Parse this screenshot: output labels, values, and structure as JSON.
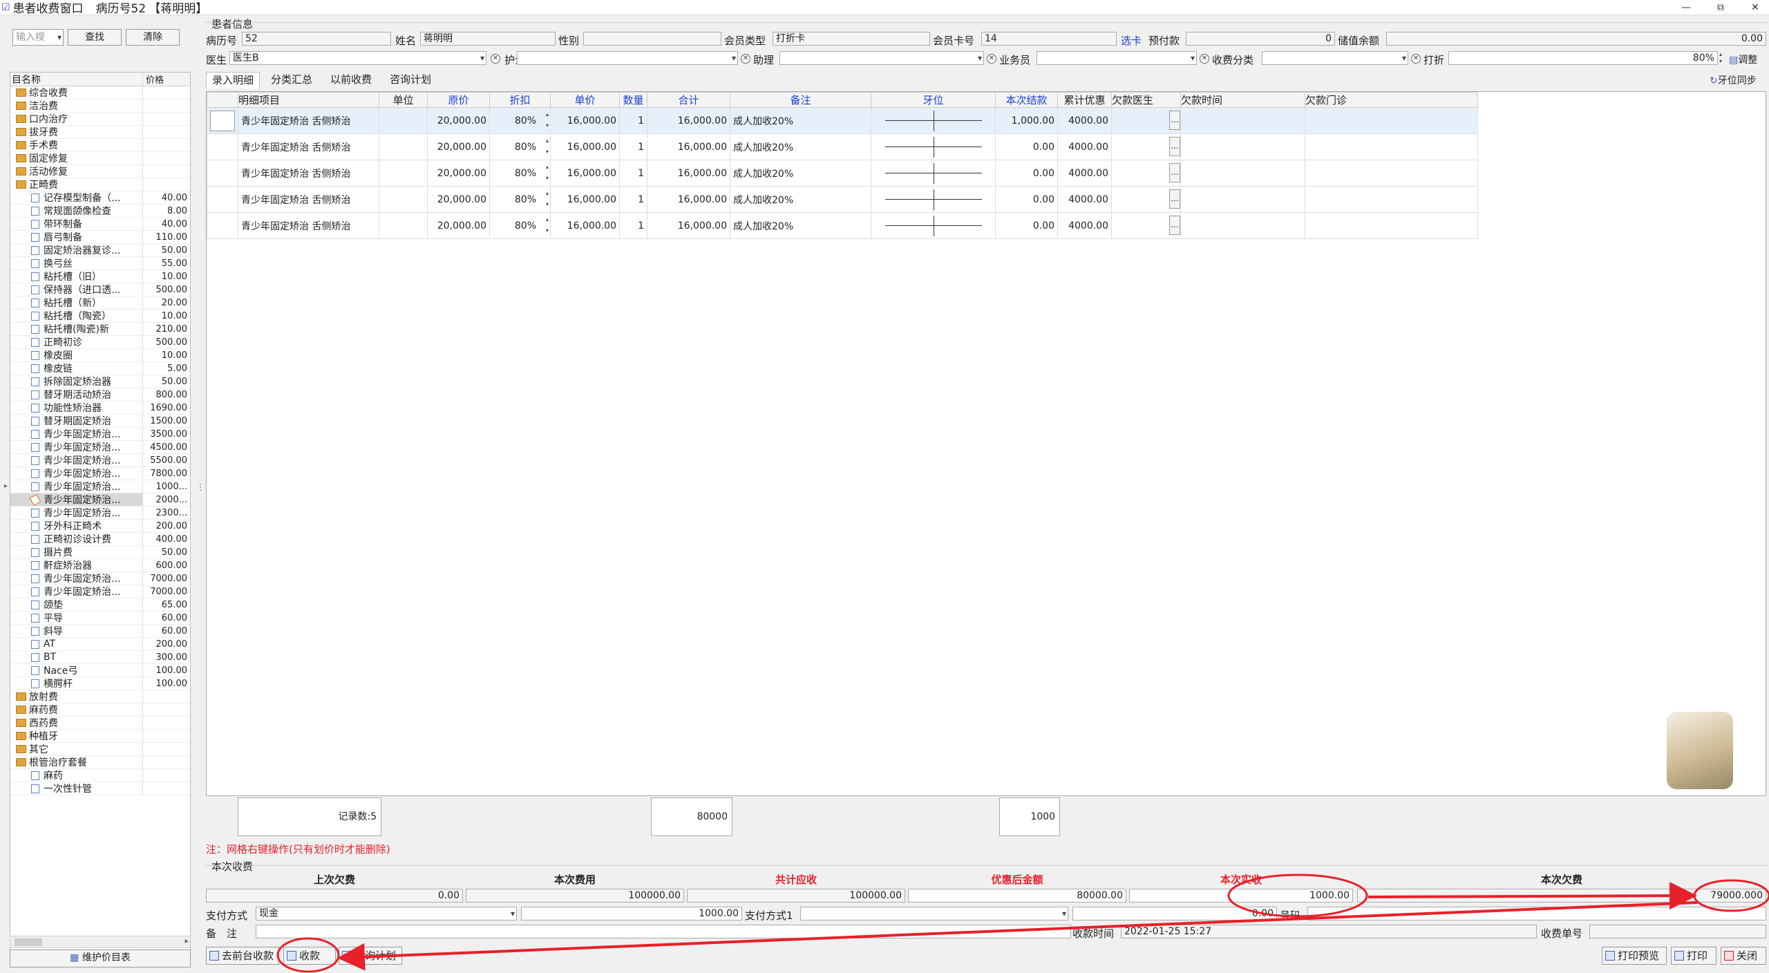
{
  "window": {
    "title": "患者收费窗口",
    "record_label": "病历号52",
    "patient_bracket": "【蒋明明】"
  },
  "sidebar": {
    "search_placeholder": "输入搜",
    "find_btn": "查找",
    "clear_btn": "清除",
    "col_name": "目名称",
    "col_price": "价格",
    "maintain_btn": "维护价目表",
    "items": [
      {
        "name": "综合收费",
        "price": "",
        "type": "folder"
      },
      {
        "name": "洁治费",
        "price": "",
        "type": "folder"
      },
      {
        "name": "口内治疗",
        "price": "",
        "type": "folder"
      },
      {
        "name": "拔牙费",
        "price": "",
        "type": "folder"
      },
      {
        "name": "手术费",
        "price": "",
        "type": "folder"
      },
      {
        "name": "固定修复",
        "price": "",
        "type": "folder"
      },
      {
        "name": "活动修复",
        "price": "",
        "type": "folder"
      },
      {
        "name": "正畸费",
        "price": "",
        "type": "folder"
      },
      {
        "name": "记存模型制备（...",
        "price": "40.00",
        "type": "leaf"
      },
      {
        "name": "常规面颌像检查",
        "price": "8.00",
        "type": "leaf"
      },
      {
        "name": "带环制备",
        "price": "40.00",
        "type": "leaf"
      },
      {
        "name": "唇弓制备",
        "price": "110.00",
        "type": "leaf"
      },
      {
        "name": "固定矫治器复诊...",
        "price": "50.00",
        "type": "leaf"
      },
      {
        "name": "换弓丝",
        "price": "55.00",
        "type": "leaf"
      },
      {
        "name": "粘托槽（旧）",
        "price": "10.00",
        "type": "leaf"
      },
      {
        "name": "保持器（进口透...",
        "price": "500.00",
        "type": "leaf"
      },
      {
        "name": "粘托槽（新）",
        "price": "20.00",
        "type": "leaf"
      },
      {
        "name": "粘托槽（陶瓷）",
        "price": "10.00",
        "type": "leaf"
      },
      {
        "name": "粘托槽(陶瓷)新",
        "price": "210.00",
        "type": "leaf"
      },
      {
        "name": "正畸初诊",
        "price": "500.00",
        "type": "leaf"
      },
      {
        "name": "橡皮圈",
        "price": "10.00",
        "type": "leaf"
      },
      {
        "name": "橡皮链",
        "price": "5.00",
        "type": "leaf"
      },
      {
        "name": "拆除固定矫治器",
        "price": "50.00",
        "type": "leaf"
      },
      {
        "name": "替牙期活动矫治",
        "price": "800.00",
        "type": "leaf"
      },
      {
        "name": "功能性矫治器",
        "price": "1690.00",
        "type": "leaf"
      },
      {
        "name": "替牙期固定矫治",
        "price": "1500.00",
        "type": "leaf"
      },
      {
        "name": "青少年固定矫治...",
        "price": "3500.00",
        "type": "leaf"
      },
      {
        "name": "青少年固定矫治...",
        "price": "4500.00",
        "type": "leaf"
      },
      {
        "name": "青少年固定矫治...",
        "price": "5500.00",
        "type": "leaf"
      },
      {
        "name": "青少年固定矫治...",
        "price": "7800.00",
        "type": "leaf"
      },
      {
        "name": "青少年固定矫治...",
        "price": "1000...",
        "type": "leaf"
      },
      {
        "name": "青少年固定矫治...",
        "price": "2000...",
        "type": "sel"
      },
      {
        "name": "青少年固定矫治...",
        "price": "2300...",
        "type": "leaf"
      },
      {
        "name": "牙外科正畸术",
        "price": "200.00",
        "type": "leaf"
      },
      {
        "name": "正畸初诊设计费",
        "price": "400.00",
        "type": "leaf"
      },
      {
        "name": "摄片费",
        "price": "50.00",
        "type": "leaf"
      },
      {
        "name": "鼾症矫治器",
        "price": "600.00",
        "type": "leaf"
      },
      {
        "name": "青少年固定矫治...",
        "price": "7000.00",
        "type": "leaf"
      },
      {
        "name": "青少年固定矫治...",
        "price": "7000.00",
        "type": "leaf"
      },
      {
        "name": "颌垫",
        "price": "65.00",
        "type": "leaf"
      },
      {
        "name": "平导",
        "price": "60.00",
        "type": "leaf"
      },
      {
        "name": "斜导",
        "price": "60.00",
        "type": "leaf"
      },
      {
        "name": "AT",
        "price": "200.00",
        "type": "leaf"
      },
      {
        "name": "BT",
        "price": "300.00",
        "type": "leaf"
      },
      {
        "name": "Nace弓",
        "price": "100.00",
        "type": "leaf"
      },
      {
        "name": "横腭杆",
        "price": "100.00",
        "type": "leaf"
      },
      {
        "name": "放射费",
        "price": "",
        "type": "folder"
      },
      {
        "name": "麻药费",
        "price": "",
        "type": "folder"
      },
      {
        "name": "西药费",
        "price": "",
        "type": "folder"
      },
      {
        "name": "种植牙",
        "price": "",
        "type": "folder"
      },
      {
        "name": "其它",
        "price": "",
        "type": "folder"
      },
      {
        "name": "根管治疗套餐",
        "price": "",
        "type": "folder"
      },
      {
        "name": "麻药",
        "price": "",
        "type": "leaf"
      },
      {
        "name": "一次性针管",
        "price": "",
        "type": "leaf"
      }
    ]
  },
  "patient": {
    "section_title": "患者信息",
    "record_no_label": "病历号",
    "record_no": "52",
    "name_label": "姓名",
    "name": "蒋明明",
    "gender_label": "性别",
    "gender": "",
    "member_type_label": "会员类型",
    "member_type": "打折卡",
    "card_no_label": "会员卡号",
    "card_no": "14",
    "select_card": "选卡",
    "prepay_label": "预付款",
    "prepay": "0",
    "stored_label": "储值余额",
    "stored": "0.00",
    "doctor_label": "医生",
    "doctor": "医生B",
    "nurse_label": "护士",
    "nurse": "",
    "assistant_label": "助理",
    "assistant": "",
    "sales_label": "业务员",
    "sales": "",
    "fee_cat_label": "收费分类",
    "fee_cat": "",
    "discount_label": "打折",
    "discount": "80%",
    "adjust": "调整"
  },
  "tabs": [
    "录入明细",
    "分类汇总",
    "以前收费",
    "咨询计划"
  ],
  "tooth_sync": "牙位同步",
  "grid": {
    "headers": [
      "明细项目",
      "单位",
      "原价",
      "折扣",
      "单价",
      "数量",
      "合计",
      "备注",
      "牙位",
      "本次结款",
      "累计优惠",
      "欠款医生",
      "欠款时间",
      "欠款门诊"
    ],
    "rows": [
      {
        "item": "青少年固定矫治 舌侧矫治",
        "unit": "",
        "orig": "20,000.00",
        "disc": "80%",
        "price": "16,000.00",
        "qty": "1",
        "total": "16,000.00",
        "note": "成人加收20%",
        "pay": "1,000.00",
        "acc": "4000.00"
      },
      {
        "item": "青少年固定矫治 舌侧矫治",
        "unit": "",
        "orig": "20,000.00",
        "disc": "80%",
        "price": "16,000.00",
        "qty": "1",
        "total": "16,000.00",
        "note": "成人加收20%",
        "pay": "0.00",
        "acc": "4000.00"
      },
      {
        "item": "青少年固定矫治 舌侧矫治",
        "unit": "",
        "orig": "20,000.00",
        "disc": "80%",
        "price": "16,000.00",
        "qty": "1",
        "total": "16,000.00",
        "note": "成人加收20%",
        "pay": "0.00",
        "acc": "4000.00"
      },
      {
        "item": "青少年固定矫治 舌侧矫治",
        "unit": "",
        "orig": "20,000.00",
        "disc": "80%",
        "price": "16,000.00",
        "qty": "1",
        "total": "16,000.00",
        "note": "成人加收20%",
        "pay": "0.00",
        "acc": "4000.00"
      },
      {
        "item": "青少年固定矫治 舌侧矫治",
        "unit": "",
        "orig": "20,000.00",
        "disc": "80%",
        "price": "16,000.00",
        "qty": "1",
        "total": "16,000.00",
        "note": "成人加收20%",
        "pay": "0.00",
        "acc": "4000.00"
      }
    ],
    "record_count": "记录数:5",
    "sum_total": "80000",
    "sum_pay": "1000"
  },
  "note_red": "注：网格右键操作(只有划价时才能删除)",
  "charge": {
    "section_title": "本次收费",
    "last_owed_label": "上次欠费",
    "last_owed": "0.00",
    "this_fee_label": "本次费用",
    "this_fee": "100000.00",
    "total_due_label": "共计应收",
    "total_due": "100000.00",
    "after_disc_label": "优惠后金额",
    "after_disc": "80000.00",
    "actual_label": "本次实收",
    "actual": "1000.00",
    "owed_label": "本次欠费",
    "owed": "79000.000",
    "pay_method_label": "支付方式",
    "pay_method": "现金",
    "pay_amount": "1000.00",
    "pay_method1_label": "支付方式1",
    "pay_method1": "",
    "pay_amount1": "0.00",
    "number_label": "号码",
    "remark_label": "备　注",
    "remark": "",
    "time_label": "收款时间",
    "time": "2022-01-25 15:27",
    "receipt_label": "收费单号",
    "receipt": ""
  },
  "buttons": {
    "front_desk": "去前台收款",
    "collect": "收款",
    "plan": "咨询计划",
    "preview": "打印预览",
    "print": "打印",
    "close": "关闭"
  },
  "colors": {
    "red": "#e8202a",
    "blue": "#1a3fd6"
  }
}
